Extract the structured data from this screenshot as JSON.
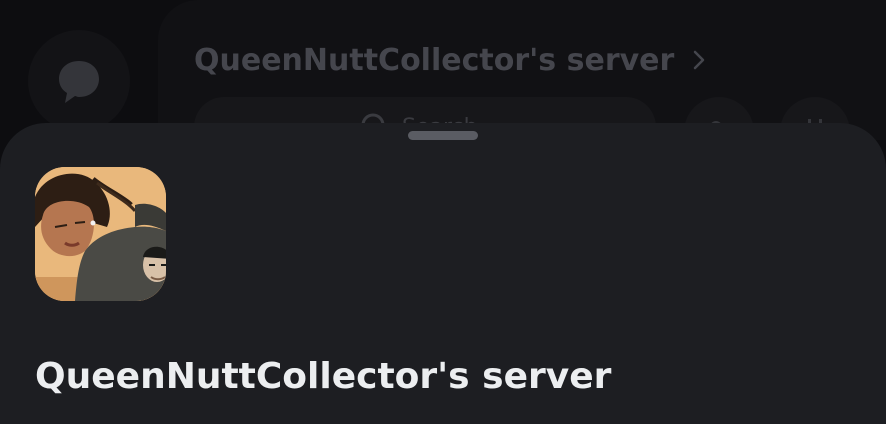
{
  "background": {
    "server_name": "QueenNuttCollector's server",
    "search_placeholder": "Search",
    "icons": [
      "chat-bubble-icon",
      "chevron-right-icon",
      "search-icon",
      "add-member-icon",
      "calendar-icon"
    ]
  },
  "sheet": {
    "server_name": "QueenNuttCollector's server",
    "server_icon": "server-avatar-illustration"
  },
  "colors": {
    "sheet_background": "#1d1e22",
    "title_text": "#eceef0",
    "dimmed_text": "#45464d"
  }
}
